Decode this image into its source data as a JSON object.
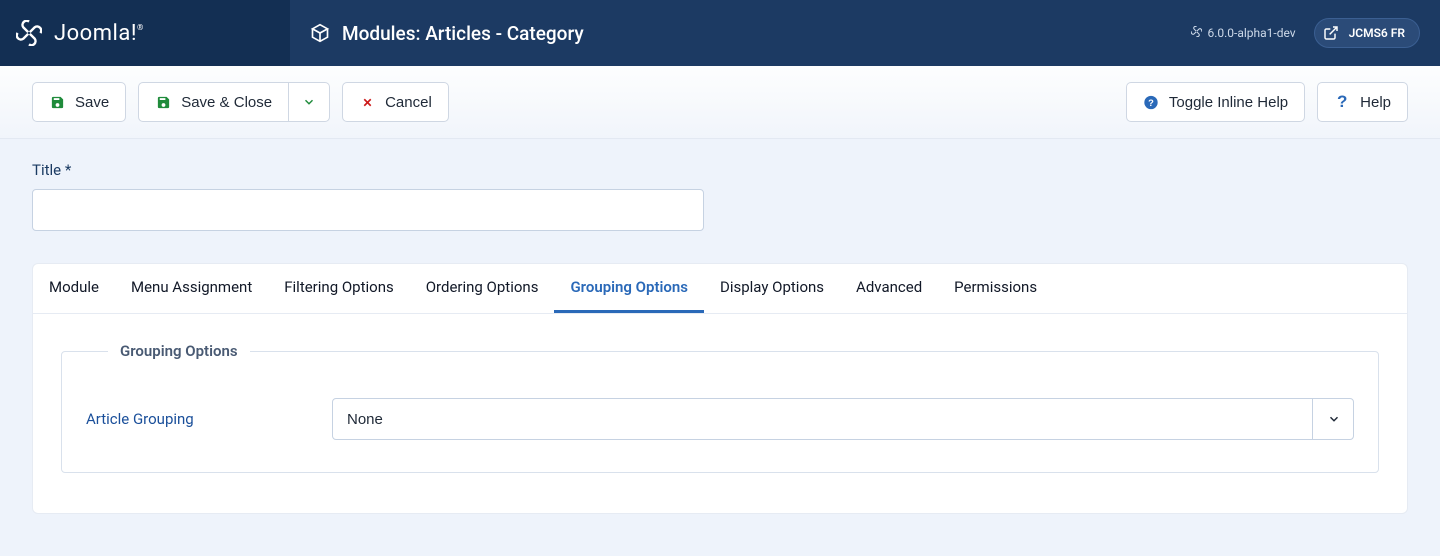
{
  "brand": {
    "name": "Joomla!"
  },
  "header": {
    "title": "Modules: Articles - Category",
    "version": "6.0.0-alpha1-dev",
    "user": "JCMS6 FR"
  },
  "toolbar": {
    "save": "Save",
    "save_close": "Save & Close",
    "cancel": "Cancel",
    "toggle_help": "Toggle Inline Help",
    "help": "Help"
  },
  "form": {
    "title_label": "Title *",
    "title_value": ""
  },
  "tabs": [
    {
      "label": "Module",
      "active": false
    },
    {
      "label": "Menu Assignment",
      "active": false
    },
    {
      "label": "Filtering Options",
      "active": false
    },
    {
      "label": "Ordering Options",
      "active": false
    },
    {
      "label": "Grouping Options",
      "active": true
    },
    {
      "label": "Display Options",
      "active": false
    },
    {
      "label": "Advanced",
      "active": false
    },
    {
      "label": "Permissions",
      "active": false
    }
  ],
  "grouping": {
    "legend": "Grouping Options",
    "article_grouping_label": "Article Grouping",
    "article_grouping_value": "None"
  },
  "colors": {
    "save_icon": "#1f8b3b",
    "cancel_icon": "#cc1818",
    "info_icon": "#2a69b8",
    "help_icon": "#2a69b8"
  }
}
